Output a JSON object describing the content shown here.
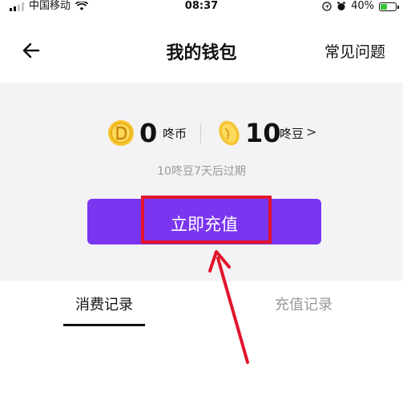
{
  "status_bar": {
    "carrier": "中国移动",
    "time": "08:37",
    "battery_percent": "40%",
    "icons": [
      "signal-icon",
      "wifi-icon",
      "location-icon",
      "alarm-icon",
      "battery-charging-icon"
    ]
  },
  "nav": {
    "title": "我的钱包",
    "faq_label": "常见问题",
    "back_icon": "back-arrow-icon"
  },
  "wallet": {
    "coin_amount": "0",
    "coin_unit": "咚币",
    "bean_amount": "10",
    "bean_unit": "咚豆",
    "chevron": ">",
    "expire_note": "10咚豆7天后过期",
    "recharge_label": "立即充值"
  },
  "tabs": [
    {
      "label": "消费记录",
      "active": true
    },
    {
      "label": "充值记录",
      "active": false
    }
  ],
  "colors": {
    "accent_purple": "#7b35f0",
    "annotation_red": "#e2142b",
    "coin_yellow": "#f6c32a",
    "card_bg": "#f3f3f5"
  }
}
